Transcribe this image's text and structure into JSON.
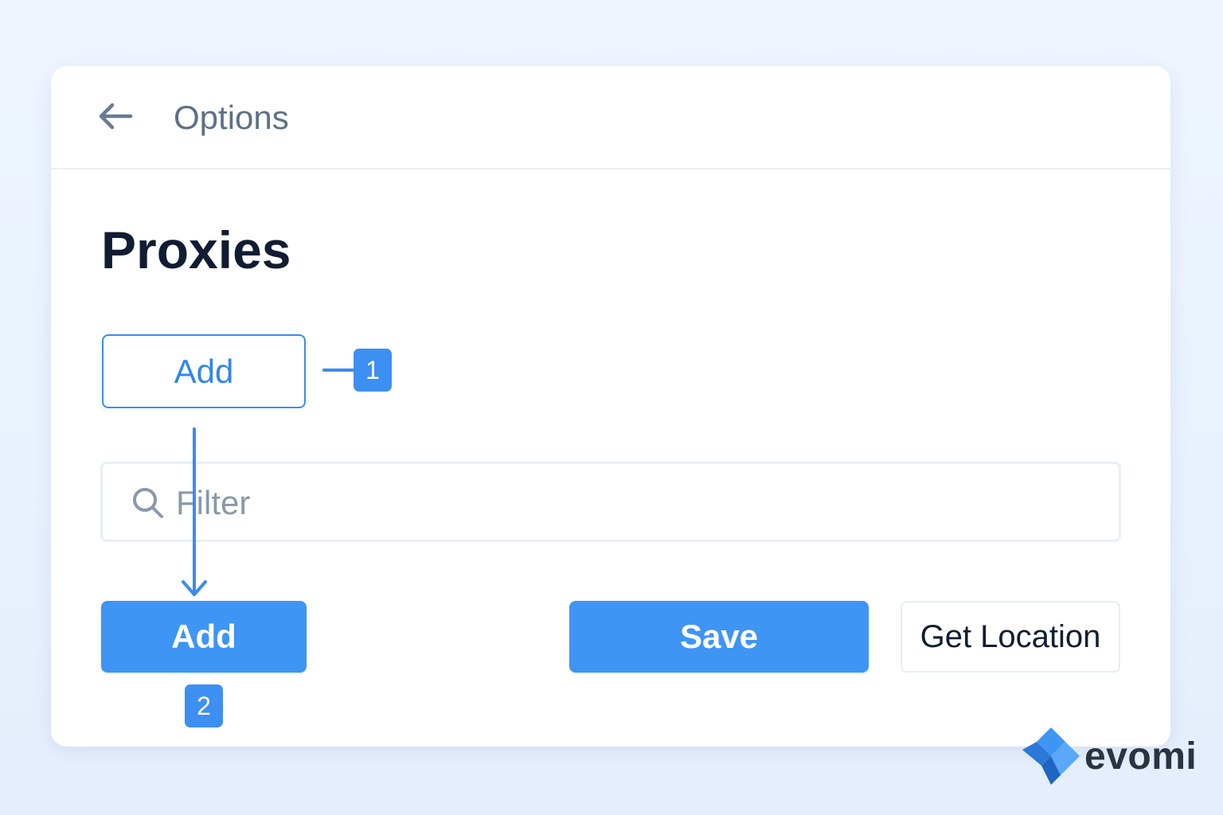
{
  "header": {
    "back_icon": "arrow-left-icon",
    "title": "Options"
  },
  "page": {
    "title": "Proxies"
  },
  "add_outline_button": {
    "label": "Add"
  },
  "callouts": [
    {
      "number": "1"
    },
    {
      "number": "2"
    }
  ],
  "filter": {
    "icon": "search-icon",
    "placeholder": "Filter",
    "value": ""
  },
  "actions": {
    "add_label": "Add",
    "save_label": "Save",
    "get_location_label": "Get Location"
  },
  "brand": {
    "name": "evomi",
    "icon": "evomi-logo-icon"
  },
  "colors": {
    "accent": "#3f95f4",
    "title": "#101c33",
    "muted": "#5f6f86"
  }
}
